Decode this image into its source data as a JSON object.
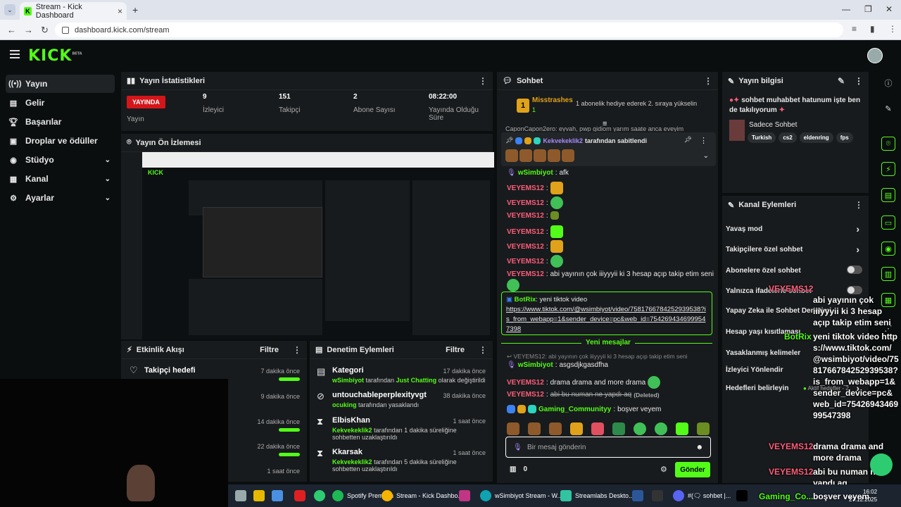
{
  "browser": {
    "tab_title": "Stream - Kick Dashboard",
    "url": "dashboard.kick.com/stream"
  },
  "app": {
    "logo": "KICK",
    "logo_badge": "BETA"
  },
  "sidebar": {
    "items": [
      {
        "label": "Yayın",
        "icon": "broadcast-icon"
      },
      {
        "label": "Gelir",
        "icon": "revenue-icon"
      },
      {
        "label": "Başarılar",
        "icon": "trophy-icon"
      },
      {
        "label": "Droplar ve ödüller",
        "icon": "gift-icon"
      },
      {
        "label": "Stüdyo",
        "icon": "studio-icon"
      },
      {
        "label": "Kanal",
        "icon": "channel-icon"
      },
      {
        "label": "Ayarlar",
        "icon": "gear-icon"
      }
    ]
  },
  "stats": {
    "title": "Yayın İstatistikleri",
    "live_label": "YAYINDA",
    "live_sub": "Yayın",
    "viewers": {
      "value": "9",
      "label": "İzleyici"
    },
    "followers": {
      "value": "151",
      "label": "Takipçi"
    },
    "subs": {
      "value": "2",
      "label": "Abone Sayısı"
    },
    "uptime": {
      "value": "08:22:00",
      "label": "Yayında Olduğu Süre"
    }
  },
  "preview": {
    "title": "Yayın Ön İzlemesi"
  },
  "events": {
    "title": "Etkinlik Akışı",
    "filter": "Filtre",
    "items": [
      {
        "title": "Takipçi hedefi",
        "time": "7 dakika önce"
      },
      {
        "title": "",
        "time": "9 dakika önce"
      },
      {
        "title": "",
        "time": "14 dakika önce"
      },
      {
        "title": "",
        "time": "22 dakika önce"
      },
      {
        "title": "",
        "time": "1 saat önce"
      }
    ]
  },
  "moderation": {
    "title": "Denetim Eylemleri",
    "filter": "Filtre",
    "items": [
      {
        "title": "Kategori",
        "user": "wSimbiyot",
        "mid": " tarafından ",
        "target": "Just Chatting",
        "rest": " olarak değiştirildi",
        "time": "17 dakika önce"
      },
      {
        "title": "untouchableperplexityvgt",
        "user": "ocuking",
        "mid": " tarafından yasaklandı",
        "target": "",
        "rest": "",
        "time": "38 dakika önce"
      },
      {
        "title": "ElbisKhan",
        "user": "Kekvekeklik2",
        "mid": " tarafından 1 dakika süreliğine sohbetten uzaklaştırıldı",
        "target": "",
        "rest": "",
        "time": "1 saat önce"
      },
      {
        "title": "Kkarsak",
        "user": "Kekvekeklik2",
        "mid": " tarafından 5 dakika süreliğine sohbetten uzaklaştırıldı",
        "target": "",
        "rest": "",
        "time": "1 saat önce"
      }
    ]
  },
  "chat": {
    "title": "Sohbet",
    "top_user": "Misstrashes",
    "top_count": "1",
    "top_msg": "1 abonelik hediye ederek 2. sıraya yükselin",
    "clipped": "CaponCapon2ero: eyvah, pwp gidiom yarım saate anca eveyim",
    "pinned_user": "Kekvekeklik2",
    "pinned_by": " tarafından sabitlendi",
    "messages": [
      {
        "user": "wSimbiyot",
        "text": "afk"
      },
      {
        "user": "VEYEMS12",
        "text": ""
      },
      {
        "user": "VEYEMS12",
        "text": ""
      },
      {
        "user": "VEYEMS12",
        "text": ""
      },
      {
        "user": "VEYEMS12",
        "text": ""
      },
      {
        "user": "VEYEMS12",
        "text": ""
      },
      {
        "user": "VEYEMS12",
        "text": ""
      },
      {
        "user": "VEYEMS12",
        "text": "abi yayının çok iiiyyyii ki 3 hesap açıp takip etim seni"
      }
    ],
    "bot_user": "BotRix",
    "bot_text": "yeni tiktok video",
    "bot_link": "https://www.tiktok.com/@wsimbiyot/video/7581766784252939538?is_from_webapp=1&sender_device=pc&web_id=7542694346999547398",
    "new_messages": "Yeni mesajlar",
    "reply_hint": "VEYEMS12: abi yayının çok iiiyyyii ki 3 hesap açıp takip etim seni",
    "after": [
      {
        "user": "wSimbiyot",
        "text": "asgsdjkgasdfha"
      },
      {
        "user": "VEYEMS12",
        "text": "drama drama and more drama"
      },
      {
        "user": "VEYEMS12",
        "text": "abi bu numan ne yapdı aq",
        "note": "(Deleted)"
      },
      {
        "user": "Gaming_Communityy",
        "text": "boşver veyem"
      }
    ],
    "input_placeholder": "Bir mesaj gönderin",
    "points": "0",
    "send": "Gönder"
  },
  "stream_info": {
    "title": "Yayın bilgisi",
    "text": "sohbet muhabbet hatunum işte ben de takılıyorum",
    "category": "Sadece Sohbet",
    "tags": [
      "Turkish",
      "cs2",
      "eldenring",
      "fps"
    ]
  },
  "channel_actions": {
    "title": "Kanal Eylemleri",
    "items": [
      {
        "label": "Yavaş mod",
        "kind": "chevron"
      },
      {
        "label": "Takipçilere özel sohbet",
        "kind": "chevron"
      },
      {
        "label": "Abonelere özel sohbet",
        "kind": "toggle"
      },
      {
        "label": "Yalnızca ifadelerle sohbet",
        "kind": "toggle"
      },
      {
        "label": "Yapay Zeka ile Sohbet Denetimi",
        "kind": "none"
      },
      {
        "label": "Hesap yaşı kısıtlaması",
        "kind": "none"
      },
      {
        "label": "Yasaklanmış kelimeler",
        "kind": "none"
      },
      {
        "label": "İzleyici Yönlendir",
        "kind": "none"
      },
      {
        "label": "Hedefleri belirleyin",
        "kind": "chevron",
        "extra": "Aktif hedefler - 2"
      }
    ]
  },
  "overlay_chat": [
    {
      "user": "VEYEMS12",
      "text": "abi yayının çok iiiyyyii ki 3 hesap açıp takip etim seni"
    },
    {
      "user": "BotRix",
      "text": "yeni tiktok video https://www.tiktok.com/@wsimbiyot/video/7581766784252939538?is_from_webapp=1&sender_device=pc&web_id=7542694346999547398"
    },
    {
      "user": "VEYEMS12",
      "text": "drama drama and more drama"
    },
    {
      "user": "VEYEMS12",
      "text": "abi bu numan ne yapdı aq"
    },
    {
      "user": "Gaming_Co...",
      "text": "boşver veyem"
    }
  ],
  "taskbar": {
    "items": [
      "Spotify Premium",
      "Stream - Kick Dashbo...",
      "wSimbiyot Stream - W...",
      "Streamlabs Deskto...",
      "#(🗨 sohbet |..."
    ],
    "time": "16:02",
    "date": "27.12.2025"
  }
}
